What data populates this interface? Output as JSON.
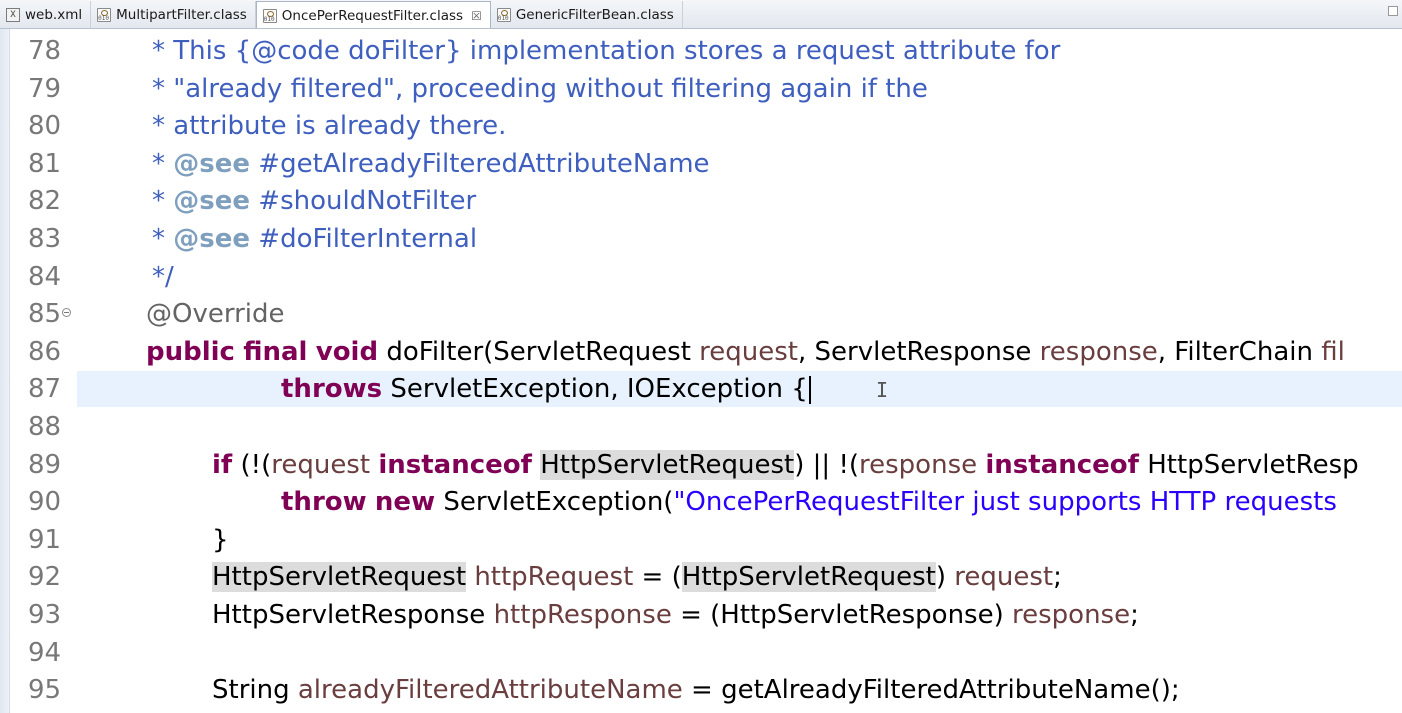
{
  "tabs": [
    {
      "label": "web.xml",
      "icon": "xml-file-icon",
      "active": false
    },
    {
      "label": "MultipartFilter.class",
      "icon": "class-file-icon",
      "active": false
    },
    {
      "label": "OncePerRequestFilter.class",
      "icon": "class-file-icon",
      "active": true,
      "close": "☒"
    },
    {
      "label": "GenericFilterBean.class",
      "icon": "class-file-icon",
      "active": false
    }
  ],
  "colors": {
    "keyword": "#7f0055",
    "javadoc": "#3f5fbf",
    "javadoc_tag": "#7f9fbf",
    "string": "#2a00ff",
    "parameter": "#6a3e3e",
    "annotation": "#646464",
    "current_line": "#e8f2fe",
    "occurrence_highlight": "#dcdcdc"
  },
  "editor": {
    "current_line_number": "87",
    "lines": [
      {
        "n": "78",
        "tokens": [
          {
            "t": "jd",
            "v": "* This {@code doFilter} implementation stores a request attribute for"
          }
        ]
      },
      {
        "n": "79",
        "tokens": [
          {
            "t": "jd",
            "v": "* \"already filtered\", proceeding without filtering again if the"
          }
        ]
      },
      {
        "n": "80",
        "tokens": [
          {
            "t": "jd",
            "v": "* attribute is already there."
          }
        ]
      },
      {
        "n": "81",
        "tokens": [
          {
            "t": "jd",
            "v": "* "
          },
          {
            "t": "jdtag",
            "v": "@see"
          },
          {
            "t": "jd",
            "v": " #getAlreadyFilteredAttributeName"
          }
        ]
      },
      {
        "n": "82",
        "tokens": [
          {
            "t": "jd",
            "v": "* "
          },
          {
            "t": "jdtag",
            "v": "@see"
          },
          {
            "t": "jd",
            "v": " #shouldNotFilter"
          }
        ]
      },
      {
        "n": "83",
        "tokens": [
          {
            "t": "jd",
            "v": "* "
          },
          {
            "t": "jdtag",
            "v": "@see"
          },
          {
            "t": "jd",
            "v": " #doFilterInternal"
          }
        ]
      },
      {
        "n": "84",
        "tokens": [
          {
            "t": "jd",
            "v": "*/"
          }
        ]
      },
      {
        "n": "85",
        "fold": true,
        "tokens": [
          {
            "t": "ann",
            "v": "@Override"
          }
        ]
      },
      {
        "n": "86",
        "tokens": [
          {
            "t": "kw",
            "v": "public"
          },
          {
            "t": "pl",
            "v": " "
          },
          {
            "t": "kw",
            "v": "final"
          },
          {
            "t": "pl",
            "v": " "
          },
          {
            "t": "kw",
            "v": "void"
          },
          {
            "t": "pl",
            "v": " doFilter(ServletRequest "
          },
          {
            "t": "par",
            "v": "request"
          },
          {
            "t": "pl",
            "v": ", ServletResponse "
          },
          {
            "t": "par",
            "v": "response"
          },
          {
            "t": "pl",
            "v": ", FilterChain "
          },
          {
            "t": "par",
            "v": "fil"
          }
        ]
      },
      {
        "n": "87",
        "tokens": [
          {
            "t": "kw",
            "v": "throws"
          },
          {
            "t": "pl",
            "v": " ServletException, IOException {"
          }
        ]
      },
      {
        "n": "88",
        "tokens": []
      },
      {
        "n": "89",
        "tokens": [
          {
            "t": "kw",
            "v": "if"
          },
          {
            "t": "pl",
            "v": " (!("
          },
          {
            "t": "par",
            "v": "request"
          },
          {
            "t": "pl",
            "v": " "
          },
          {
            "t": "kw",
            "v": "instanceof"
          },
          {
            "t": "pl",
            "v": " "
          },
          {
            "t": "hl",
            "v": "HttpServletRequest"
          },
          {
            "t": "pl",
            "v": ") || !("
          },
          {
            "t": "par",
            "v": "response"
          },
          {
            "t": "pl",
            "v": " "
          },
          {
            "t": "kw",
            "v": "instanceof"
          },
          {
            "t": "pl",
            "v": " HttpServletResp"
          }
        ]
      },
      {
        "n": "90",
        "tokens": [
          {
            "t": "kw",
            "v": "throw"
          },
          {
            "t": "pl",
            "v": " "
          },
          {
            "t": "kw",
            "v": "new"
          },
          {
            "t": "pl",
            "v": " ServletException("
          },
          {
            "t": "str",
            "v": "\"OncePerRequestFilter just supports HTTP requests"
          }
        ]
      },
      {
        "n": "91",
        "tokens": [
          {
            "t": "pl",
            "v": "}"
          }
        ]
      },
      {
        "n": "92",
        "tokens": [
          {
            "t": "hl",
            "v": "HttpServletRequest"
          },
          {
            "t": "pl",
            "v": " "
          },
          {
            "t": "par",
            "v": "httpRequest"
          },
          {
            "t": "pl",
            "v": " = ("
          },
          {
            "t": "hl",
            "v": "HttpServletRequest"
          },
          {
            "t": "pl",
            "v": ") "
          },
          {
            "t": "par",
            "v": "request"
          },
          {
            "t": "pl",
            "v": ";"
          }
        ]
      },
      {
        "n": "93",
        "tokens": [
          {
            "t": "pl",
            "v": "HttpServletResponse "
          },
          {
            "t": "par",
            "v": "httpResponse"
          },
          {
            "t": "pl",
            "v": " = (HttpServletResponse) "
          },
          {
            "t": "par",
            "v": "response"
          },
          {
            "t": "pl",
            "v": ";"
          }
        ]
      },
      {
        "n": "94",
        "tokens": []
      },
      {
        "n": "95",
        "tokens": [
          {
            "t": "pl",
            "v": "String "
          },
          {
            "t": "par",
            "v": "alreadyFilteredAttributeName"
          },
          {
            "t": "pl",
            "v": " = getAlreadyFilteredAttributeName();"
          }
        ]
      }
    ]
  }
}
